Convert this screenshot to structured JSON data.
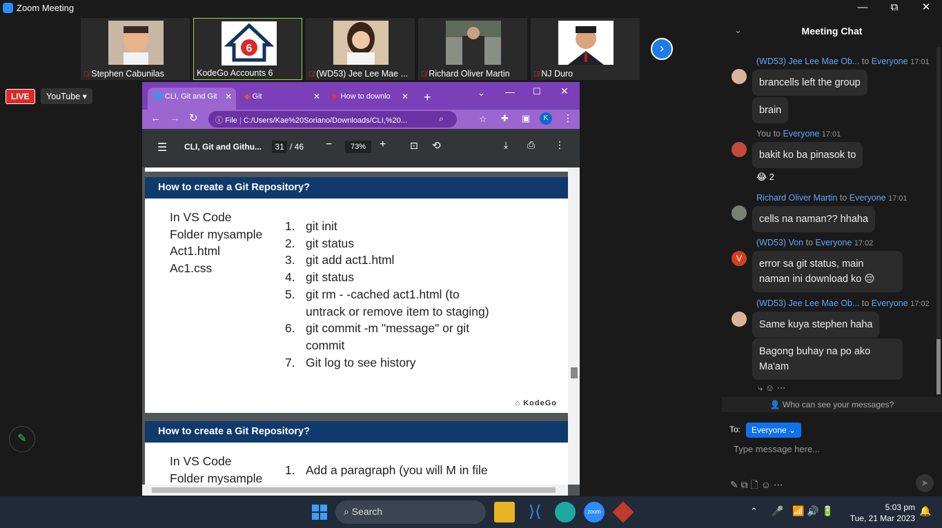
{
  "window": {
    "title": "Zoom Meeting",
    "minimize": "—",
    "maximize": "⧉",
    "close": "✕"
  },
  "participants": [
    {
      "name": "Stephen Cabunilas",
      "muted": true
    },
    {
      "name": "KodeGo Accounts 6",
      "muted": false,
      "active": true
    },
    {
      "name": "(WD53) Jee Lee Mae ...",
      "muted": true
    },
    {
      "name": "Richard Oliver Martin",
      "muted": true
    },
    {
      "name": "NJ Duro",
      "muted": true
    }
  ],
  "stream": {
    "live_label": "LIVE",
    "platform_label": "YouTube ▾"
  },
  "browser": {
    "tabs": [
      {
        "label": "CLI, Git and Git",
        "active": true
      },
      {
        "label": "Git",
        "active": false
      },
      {
        "label": "How to downlo",
        "active": false
      }
    ],
    "new_tab": "+",
    "url_prefix": "File",
    "url": "C:/Users/Kae%20Soriano/Downloads/CLI,%20...",
    "profile_initial": "K",
    "pdf": {
      "title": "CLI, Git and Githu...",
      "page_current": "31",
      "page_total": "/ 46",
      "zoom": "73%"
    }
  },
  "slides": [
    {
      "heading": "How to create a Git Repository?",
      "left_lines": [
        "In VS Code",
        "Folder mysample",
        "Act1.html",
        "Ac1.css"
      ],
      "steps": [
        {
          "n": "1.",
          "text": "git init"
        },
        {
          "n": "2.",
          "text": "git status"
        },
        {
          "n": "3.",
          "text": "git add act1.html"
        },
        {
          "n": "4.",
          "text": "git status"
        },
        {
          "n": "5.",
          "text": "git rm  - -cached act1.html (to untrack or remove item to staging)"
        },
        {
          "n": "6.",
          "text": "git commit -m \"message\"  or git commit"
        },
        {
          "n": "7.",
          "text": "Git log to see history"
        }
      ],
      "logo": "KodeGo"
    },
    {
      "heading": "How to create a Git Repository?",
      "left_lines": [
        "In VS Code",
        "Folder mysample"
      ],
      "steps": [
        {
          "n": "1.",
          "text": "Add a paragraph (you will M in file"
        }
      ]
    }
  ],
  "chat": {
    "title": "Meeting Chat",
    "messages": [
      {
        "sender": "(WD53) Jee Lee Mae Ob...",
        "to": "to",
        "recipient": "Everyone",
        "time": "17:01",
        "bubbles": [
          "brancells left the group",
          "brain"
        ]
      },
      {
        "sender": "You",
        "to": "to",
        "recipient": "Everyone",
        "time": "17:01",
        "bubbles": [
          "bakit ko ba pinasok to"
        ],
        "reaction": "😂 2"
      },
      {
        "sender": "Richard Oliver Martin",
        "to": "to",
        "recipient": "Everyone",
        "time": "17:01",
        "bubbles": [
          "cells na naman?? hhaha"
        ]
      },
      {
        "sender": "(WD53) Von",
        "to": "to",
        "recipient": "Everyone",
        "time": "17:02",
        "bubbles": [
          "error sa git status, main naman ini download ko 😔"
        ],
        "avatar_initial": "V"
      },
      {
        "sender": "(WD53) Jee Lee Mae Ob...",
        "to": "to",
        "recipient": "Everyone",
        "time": "17:02",
        "bubbles": [
          "Same kuya stephen haha",
          "Bagong buhay na po ako Ma'am"
        ]
      }
    ],
    "privacy_note": "Who can see your messages?",
    "to_label": "To:",
    "to_value": "Everyone ⌄",
    "input_placeholder": "Type message here..."
  },
  "taskbar": {
    "search_label": "Search",
    "time": "5:03 pm",
    "date": "Tue, 21 Mar 2023"
  },
  "colors": {
    "zoom_blue": "#0e72ed",
    "chrome_purple": "#7b3fb8",
    "slide_header": "#0f3a6b",
    "live_red": "#e02828"
  }
}
